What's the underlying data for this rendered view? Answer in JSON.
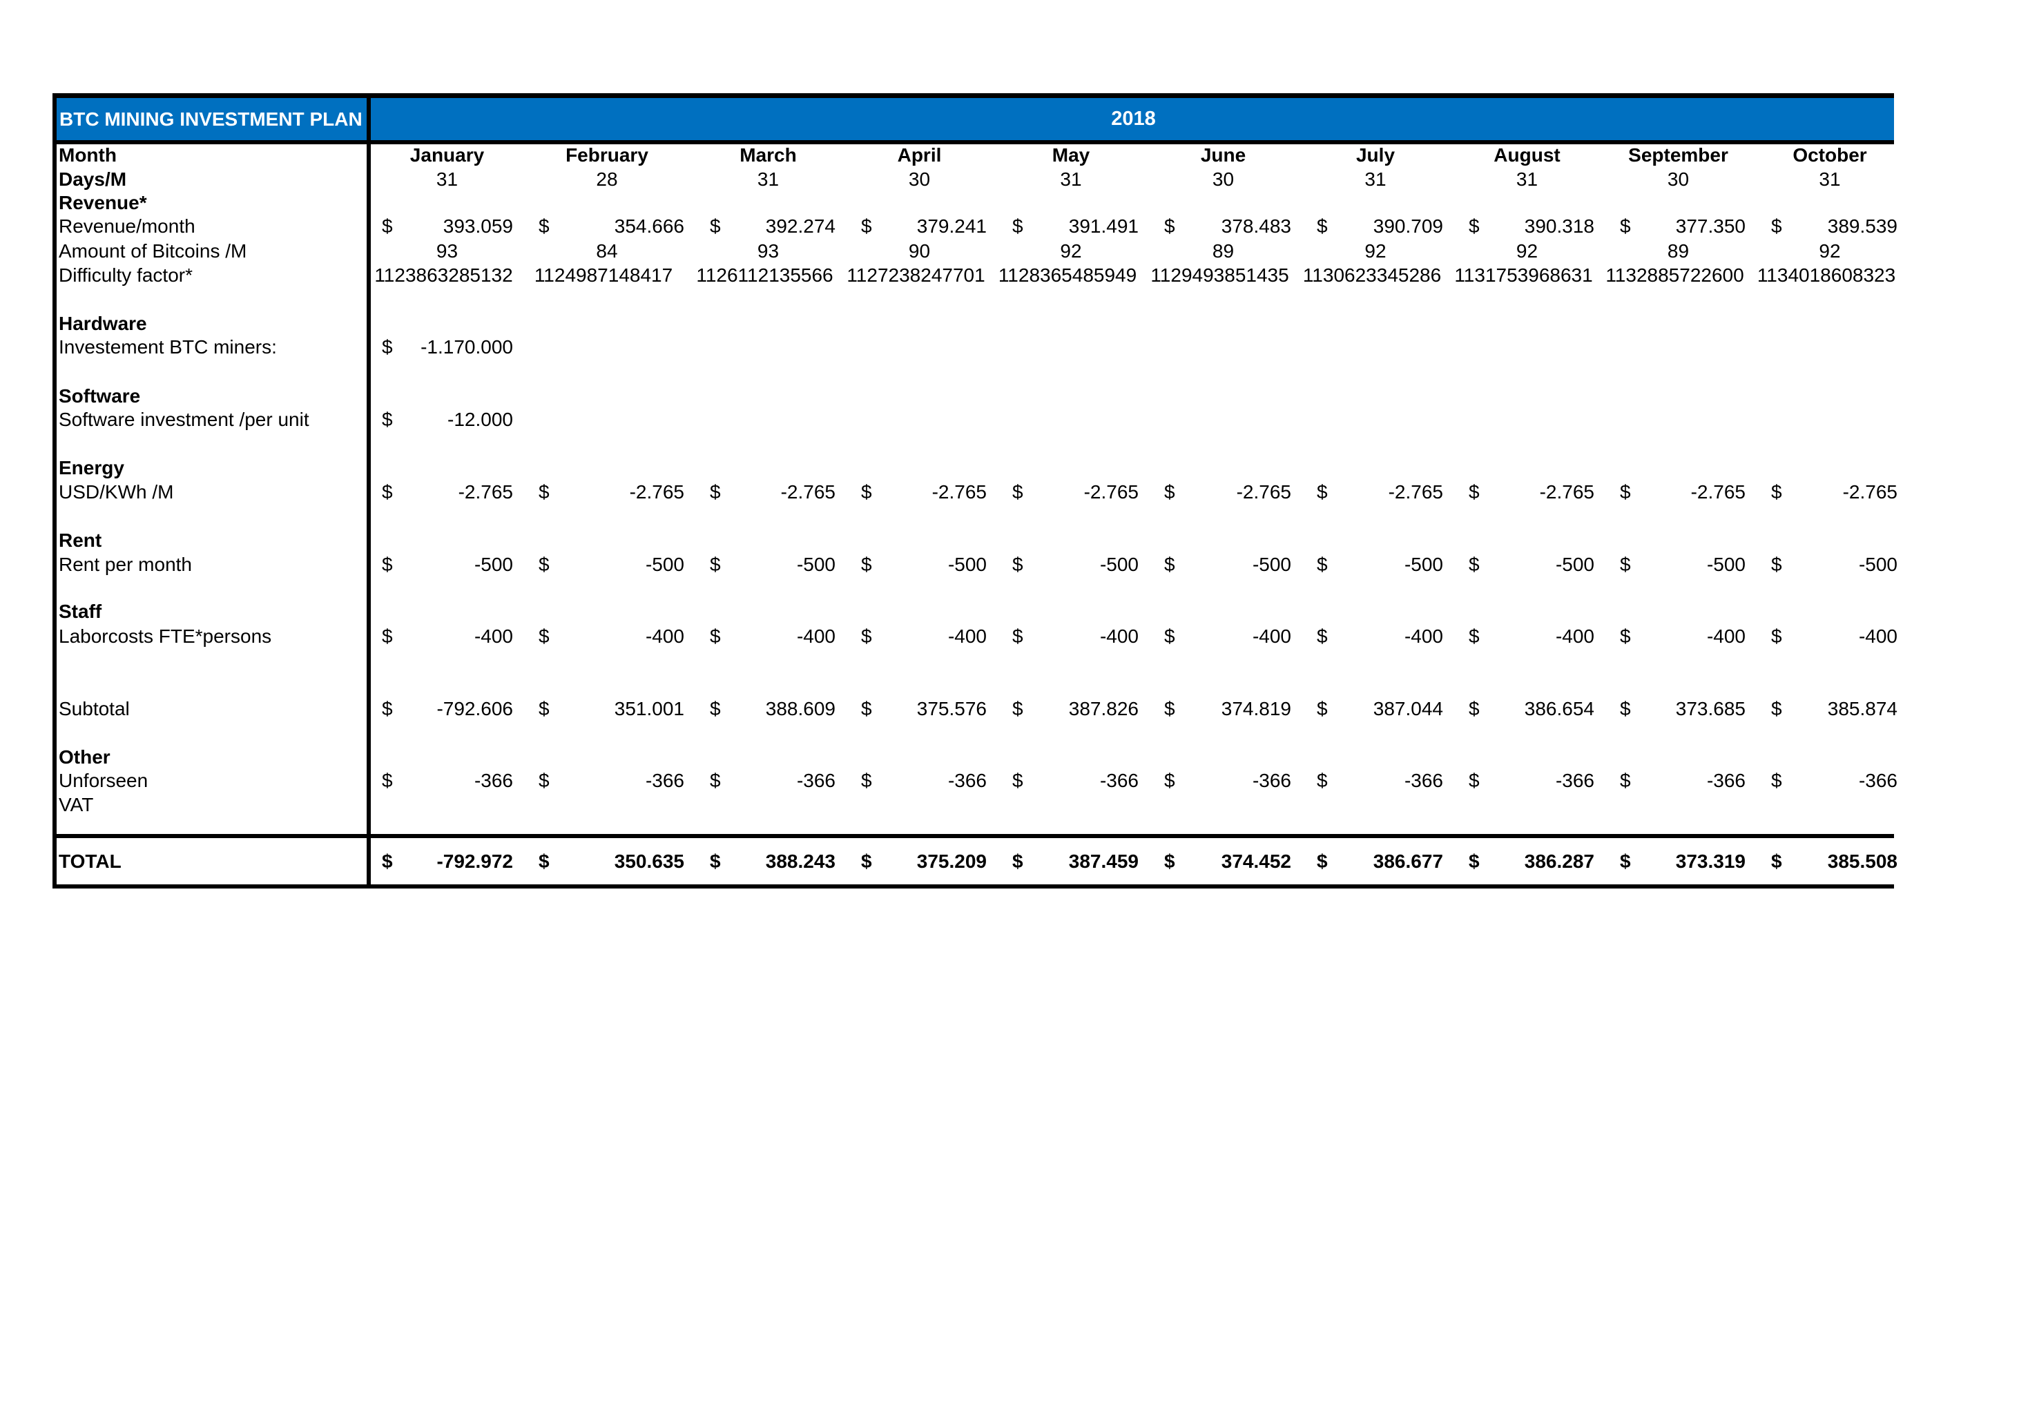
{
  "header": {
    "title": "BTC MINING INVESTMENT PLAN",
    "year": "2018",
    "accent_color": "#0070C0"
  },
  "months": [
    "January",
    "February",
    "March",
    "April",
    "May",
    "June",
    "July",
    "August",
    "September",
    "October"
  ],
  "rows": {
    "month_label": "Month",
    "days_label": "Days/M",
    "days": [
      "31",
      "28",
      "31",
      "30",
      "31",
      "30",
      "31",
      "31",
      "30",
      "31"
    ],
    "revenue_section": "Revenue*",
    "revenue_label": "Revenue/month",
    "revenue": [
      "393.059",
      "354.666",
      "392.274",
      "379.241",
      "391.491",
      "378.483",
      "390.709",
      "390.318",
      "377.350",
      "389.539"
    ],
    "bitcoins_label": "Amount of Bitcoins /M",
    "bitcoins": [
      "93",
      "84",
      "93",
      "90",
      "92",
      "89",
      "92",
      "92",
      "89",
      "92"
    ],
    "difficulty_label": "Difficulty factor*",
    "difficulty": [
      "1123863285132",
      "1124987148417",
      "1126112135566",
      "1127238247701",
      "1128365485949",
      "1129493851435",
      "1130623345286",
      "1131753968631",
      "1132885722600",
      "1134018608323"
    ],
    "hardware_section": "Hardware",
    "hardware_label": "Investement BTC miners:",
    "hardware": [
      "-1.170.000"
    ],
    "software_section": "Software",
    "software_label": "Software investment /per unit",
    "software": [
      "-12.000"
    ],
    "energy_section": "Energy",
    "energy_label": "USD/KWh /M",
    "energy": [
      "-2.765",
      "-2.765",
      "-2.765",
      "-2.765",
      "-2.765",
      "-2.765",
      "-2.765",
      "-2.765",
      "-2.765",
      "-2.765"
    ],
    "rent_section": "Rent",
    "rent_label": "Rent per month",
    "rent": [
      "-500",
      "-500",
      "-500",
      "-500",
      "-500",
      "-500",
      "-500",
      "-500",
      "-500",
      "-500"
    ],
    "staff_section": "Staff",
    "staff_label": "Laborcosts FTE*persons",
    "staff": [
      "-400",
      "-400",
      "-400",
      "-400",
      "-400",
      "-400",
      "-400",
      "-400",
      "-400",
      "-400"
    ],
    "subtotal_label": "Subtotal",
    "subtotal": [
      "-792.606",
      "351.001",
      "388.609",
      "375.576",
      "387.826",
      "374.819",
      "387.044",
      "386.654",
      "373.685",
      "385.874"
    ],
    "other_section": "Other",
    "unforseen_label": "Unforseen",
    "unforseen": [
      "-366",
      "-366",
      "-366",
      "-366",
      "-366",
      "-366",
      "-366",
      "-366",
      "-366",
      "-366"
    ],
    "vat_label": "VAT",
    "total_label": "TOTAL",
    "total": [
      "-792.972",
      "350.635",
      "388.243",
      "375.209",
      "387.459",
      "374.452",
      "386.677",
      "386.287",
      "373.319",
      "385.508"
    ]
  },
  "currency_symbol": "$"
}
